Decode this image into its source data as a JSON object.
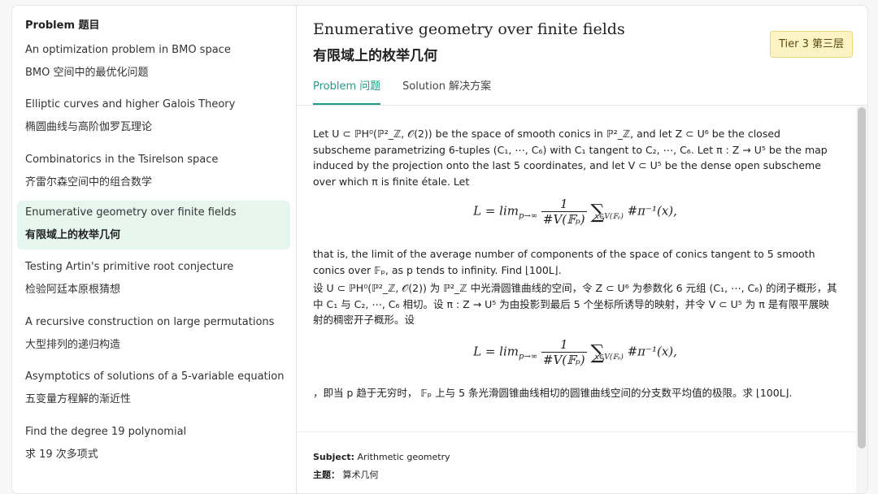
{
  "sidebar": {
    "heading": "Problem  题目",
    "items": [
      {
        "en": "An optimization problem in BMO space",
        "zh": "BMO 空间中的最优化问题"
      },
      {
        "en": "Elliptic curves and higher Galois Theory",
        "zh": "椭圆曲线与高阶伽罗瓦理论"
      },
      {
        "en": "Combinatorics in the Tsirelson space",
        "zh": "齐雷尔森空间中的组合数学"
      },
      {
        "en": "Enumerative geometry over finite fields",
        "zh": "有限域上的枚举几何"
      },
      {
        "en": "Testing Artin's primitive root conjecture",
        "zh": "检验阿廷本原根猜想"
      },
      {
        "en": "A recursive construction on large permutations",
        "zh": "大型排列的递归构造"
      },
      {
        "en": "Asymptotics of solutions of a 5-variable equation",
        "zh": "五变量方程解的渐近性"
      },
      {
        "en": "Find the degree 19 polynomial",
        "zh": "求 19 次多项式"
      }
    ],
    "active_index": 3
  },
  "header": {
    "title_en": "Enumerative geometry over finite fields",
    "title_zh": "有限域上的枚举几何",
    "tier": "Tier 3  第三层"
  },
  "tabs": [
    {
      "label": "Problem  问题",
      "active": true
    },
    {
      "label": "Solution  解决方案",
      "active": false
    }
  ],
  "problem": {
    "en_intro": "Let U ⊂ ℙH⁰(ℙ²_ℤ, 𝒪(2)) be the space of smooth conics in ℙ²_ℤ, and let Z ⊂ U⁶ be the closed subscheme parametrizing 6-tuples (C₁, ⋯, C₆) with C₁ tangent to C₂, ⋯, C₆. Let π : Z → U⁵ be the map induced by the projection onto the last 5 coordinates, and let V ⊂ U⁵ be the dense open subscheme over which π is finite étale. Let",
    "formula_lhs": "L = lim",
    "formula_lim_sub": "p→∞",
    "formula_num": "1",
    "formula_den": "#V(𝔽ₚ)",
    "formula_sum_sub": "x∈V(𝔽ₚ)",
    "formula_rhs": "#π⁻¹(x),",
    "en_outro": "that is, the limit of the average number of components of the space of conics tangent to 5 smooth conics over 𝔽ₚ, as p tends to infinity. Find ⌊100L⌋.",
    "zh_intro": "设 U ⊂ ℙH⁰(ℙ²_ℤ, 𝒪(2)) 为 ℙ²_ℤ 中光滑圆锥曲线的空间，令 Z ⊂ U⁶ 为参数化 6 元组 (C₁, ⋯, C₆) 的闭子概形，其中 C₁ 与 C₂, ⋯, C₆ 相切。设 π : Z → U⁵ 为由投影到最后 5 个坐标所诱导的映射，并令 V ⊂ U⁵ 为 π 是有限平展映射的稠密开子概形。设",
    "zh_outro": "，即当 p 趋于无穷时， 𝔽ₚ 上与 5 条光滑圆锥曲线相切的圆锥曲线空间的分支数平均值的极限。求 ⌊100L⌋."
  },
  "meta": {
    "subject_label": "Subject:",
    "subject_value": "Arithmetic geometry",
    "topic_label": "主题：",
    "topic_value": "算术几何"
  }
}
